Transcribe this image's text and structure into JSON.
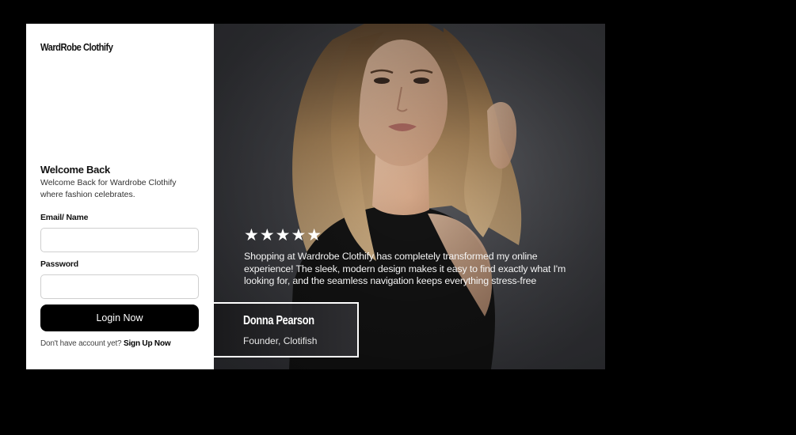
{
  "brand": {
    "name": "WardRobe Clothify"
  },
  "login": {
    "title": "Welcome Back",
    "subtitle": "Welcome Back for Wardrobe Clothify where fashion celebrates.",
    "email_label": "Email/ Name",
    "email_value": "",
    "email_placeholder": "",
    "password_label": "Password",
    "password_value": "",
    "password_placeholder": "",
    "button_label": "Login Now",
    "signup_prompt": "Don't have account yet?",
    "signup_link": "Sign Up Now"
  },
  "testimonial": {
    "rating": 5,
    "stars": "★★★★★",
    "quote": "Shopping at Wardrobe Clothify has completely transformed my online experience! The sleek, modern design makes it easy to find exactly what I'm looking for, and the seamless navigation keeps everything stress-free",
    "author_name": "Donna Pearson",
    "author_role": "Founder, Clotifish"
  },
  "icons": {
    "rating": "star-icon"
  },
  "colors": {
    "page_background": "#000000",
    "panel_background": "#ffffff",
    "button_background": "#000000",
    "button_text": "#ffffff",
    "photo_background": "#45464b"
  }
}
